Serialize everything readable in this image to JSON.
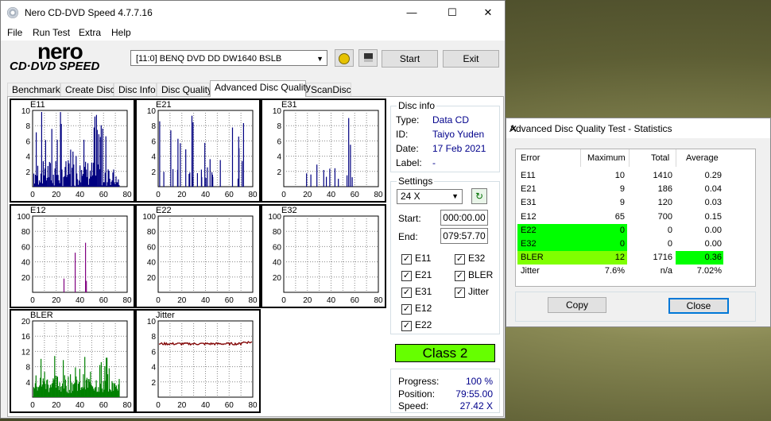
{
  "window": {
    "title": "Nero CD-DVD Speed 4.7.7.16",
    "minimize": "—",
    "maximize": "☐",
    "close": "✕"
  },
  "menu": [
    "File",
    "Run Test",
    "Extra",
    "Help"
  ],
  "logo": {
    "top": "nero",
    "bottom": "CD·DVD SPEED"
  },
  "toolbar": {
    "drive": "[11:0]   BENQ DVD DD DW1640 BSLB",
    "start": "Start",
    "exit": "Exit"
  },
  "tabs": [
    "Benchmark",
    "Create Disc",
    "Disc Info",
    "Disc Quality",
    "Advanced Disc Quality",
    "ScanDisc"
  ],
  "active_tab": "Advanced Disc Quality",
  "disc_info": {
    "caption": "Disc info",
    "type_label": "Type:",
    "type": "Data CD",
    "id_label": "ID:",
    "id": "Taiyo Yuden",
    "date_label": "Date:",
    "date": "17 Feb 2021",
    "label_label": "Label:",
    "label": "-"
  },
  "settings": {
    "caption": "Settings",
    "speed": "24 X",
    "start_label": "Start:",
    "start": "000:00.00",
    "end_label": "End:",
    "end": "079:57.70",
    "checks": [
      {
        "label": "E11",
        "checked": true
      },
      {
        "label": "E32",
        "checked": true
      },
      {
        "label": "E21",
        "checked": true
      },
      {
        "label": "BLER",
        "checked": true
      },
      {
        "label": "E31",
        "checked": true
      },
      {
        "label": "Jitter",
        "checked": true
      },
      {
        "label": "E12",
        "checked": true
      },
      {
        "label": "E22",
        "checked": true
      }
    ]
  },
  "class_result": "Class 2",
  "progress": {
    "progress_label": "Progress:",
    "progress": "100 %",
    "position_label": "Position:",
    "position": "79:55.00",
    "speed_label": "Speed:",
    "speed": "27.42 X"
  },
  "graphs": [
    {
      "name": "E11",
      "ymax": 10,
      "yticks": [
        "10",
        "8",
        "6",
        "4",
        "2"
      ],
      "color": "#000080"
    },
    {
      "name": "E21",
      "ymax": 10,
      "yticks": [
        "10",
        "8",
        "6",
        "4",
        "2"
      ],
      "color": "#000080"
    },
    {
      "name": "E31",
      "ymax": 10,
      "yticks": [
        "10",
        "8",
        "6",
        "4",
        "2"
      ],
      "color": "#000080"
    },
    {
      "name": "E12",
      "ymax": 100,
      "yticks": [
        "100",
        "80",
        "60",
        "40",
        "20"
      ],
      "color": "#800080"
    },
    {
      "name": "E22",
      "ymax": 100,
      "yticks": [
        "100",
        "80",
        "60",
        "40",
        "20"
      ],
      "color": "#000080"
    },
    {
      "name": "E32",
      "ymax": 100,
      "yticks": [
        "100",
        "80",
        "60",
        "40",
        "20"
      ],
      "color": "#000080"
    },
    {
      "name": "BLER",
      "ymax": 20,
      "yticks": [
        "20",
        "16",
        "12",
        "8",
        "4"
      ],
      "color": "#008000"
    },
    {
      "name": "Jitter",
      "ymax": 10,
      "yticks": [
        "10",
        "8",
        "6",
        "4",
        "2"
      ],
      "color": "#800000"
    }
  ],
  "xticks": [
    "0",
    "20",
    "40",
    "60",
    "80"
  ],
  "stats": {
    "title": "Advanced Disc Quality Test - Statistics",
    "close": "✕",
    "headers": {
      "error": "Error",
      "maximum": "Maximum",
      "total": "Total",
      "average": "Average"
    },
    "rows": [
      {
        "error": "E11",
        "maximum": "10",
        "total": "1410",
        "average": "0.29"
      },
      {
        "error": "E21",
        "maximum": "9",
        "total": "186",
        "average": "0.04"
      },
      {
        "error": "E31",
        "maximum": "9",
        "total": "120",
        "average": "0.03"
      },
      {
        "error": "E12",
        "maximum": "65",
        "total": "700",
        "average": "0.15"
      },
      {
        "error": "E22",
        "maximum": "0",
        "total": "0",
        "average": "0.00"
      },
      {
        "error": "E32",
        "maximum": "0",
        "total": "0",
        "average": "0.00"
      },
      {
        "error": "BLER",
        "maximum": "12",
        "total": "1716",
        "average": "0.36"
      },
      {
        "error": "Jitter",
        "maximum": "7.6%",
        "total": "n/a",
        "average": "7.02%"
      }
    ],
    "copy": "Copy",
    "close_button": "Close",
    "highlight_green": "#00ff00",
    "highlight_lime": "#80ff00"
  },
  "colors": {
    "e_series": "#000080",
    "e12_series": "#800080",
    "bler_series": "#008000",
    "jitter_series": "#800000",
    "class_ok": "#66ff00"
  }
}
